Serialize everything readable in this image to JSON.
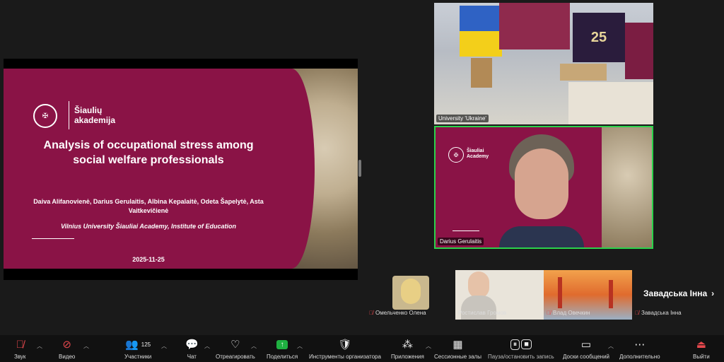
{
  "slide": {
    "logo_left": "VILNIUS UNIVERSITETAS",
    "logo_right": "Šiaulių akademija",
    "title": "Analysis of occupational stress among social welfare professionals",
    "authors": "Daiva Alifanovienė, Darius Gerulaitis, Albina Kepalaitė, Odeta Šapelytė, Asta Vaitkevičienė",
    "institution": "Vilnius University Šiauliai Academy, Institute of Education",
    "date": "2025-11-25"
  },
  "tiles": {
    "room_label": "University 'Ukraine'",
    "speaker_label": "Darius Gerulaitis",
    "speaker_logo": "Šiauliai Academy",
    "room_badge": "25"
  },
  "participants_strip": [
    {
      "name": "Омельченко Олена"
    },
    {
      "name": "Ростислав Громов"
    },
    {
      "name": "Влад Овечкин"
    },
    {
      "name": "Завадська Інна"
    }
  ],
  "strip_next_label": "Завадська Інна",
  "toolbar": {
    "audio": "Звук",
    "video": "Видео",
    "participants": "Участники",
    "participants_count": "125",
    "chat": "Чат",
    "react": "Отреагировать",
    "share": "Поделиться",
    "host_tools": "Инструменты организатора",
    "apps": "Приложения",
    "breakout": "Сессионные залы",
    "pause_record": "Пауза/остановить запись",
    "whiteboards": "Доски сообщений",
    "more": "Дополнительно",
    "leave": "Выйти"
  },
  "colors": {
    "slide_bg": "#8a1346",
    "active_speaker": "#2bd24b",
    "mic_off": "#e5484d",
    "share_green": "#1fb141"
  }
}
